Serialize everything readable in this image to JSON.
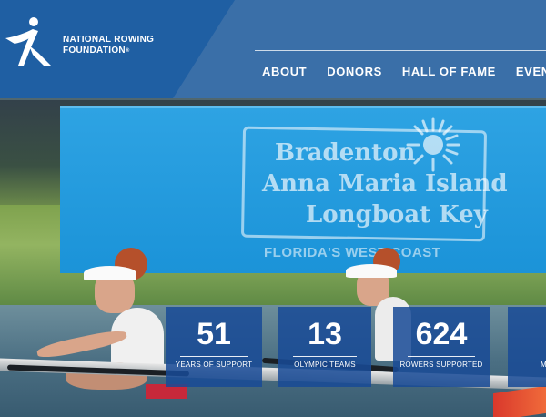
{
  "brand": {
    "name_line1": "NATIONAL ROWING",
    "name_line2": "FOUNDATION",
    "registered": "®",
    "logo_icon": "rower-figure-icon",
    "colors": {
      "header_dark": "#1f5fa3",
      "header_light": "#3a6fa8",
      "stat_tile": "#194b96"
    }
  },
  "nav": {
    "items": [
      {
        "label": "ABOUT"
      },
      {
        "label": "DONORS"
      },
      {
        "label": "HALL OF FAME"
      },
      {
        "label": "EVENTS"
      }
    ]
  },
  "banner": {
    "line1": "Bradenton",
    "line2": "Anna Maria Island",
    "line3": "Longboat Key",
    "tagline": "FLORIDA'S WEST COAST"
  },
  "stats": [
    {
      "value": "51",
      "label": "YEARS OF SUPPORT"
    },
    {
      "value": "13",
      "label": "OLYMPIC TEAMS"
    },
    {
      "value": "624",
      "label": "ROWERS SUPPORTED"
    },
    {
      "value": "",
      "label": "M"
    }
  ]
}
